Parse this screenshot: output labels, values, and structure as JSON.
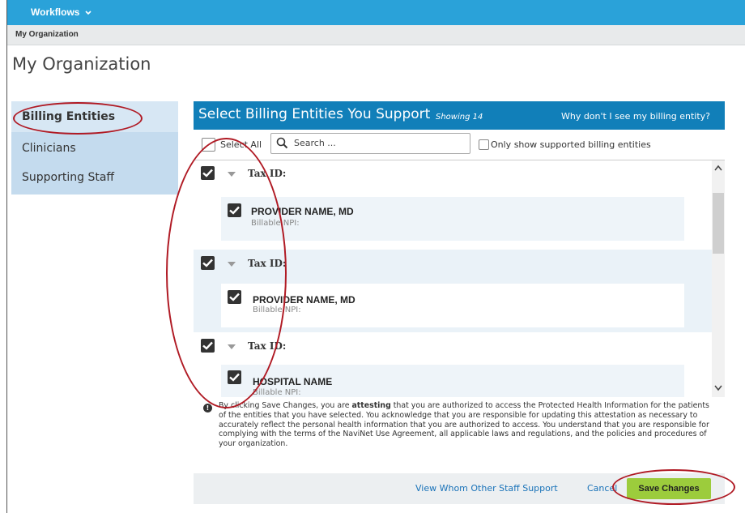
{
  "topbar": {
    "workflows_label": "Workflows",
    "chevron_icon": "chevron-down-icon",
    "color": "#2aa2d9"
  },
  "breadcrumb": {
    "label": "My Organization"
  },
  "page": {
    "title": "My Organization"
  },
  "sidebar": {
    "items": [
      {
        "label": "Billing Entities",
        "active": true
      },
      {
        "label": "Clinicians"
      },
      {
        "label": "Supporting Staff"
      }
    ]
  },
  "panel": {
    "title": "Select Billing Entities You Support",
    "showing": "Showing 14",
    "why_link": "Why don't I see my billing entity?",
    "header_color": "#117fb9"
  },
  "toolbar": {
    "select_all": "Select All",
    "search_placeholder": "Search ...",
    "only_supported": "Only show supported billing entities"
  },
  "entities": [
    {
      "tax_id_label": "Tax ID:",
      "provider": "PROVIDER NAME, MD",
      "npi_label": "Billable NPI:",
      "checked": true
    },
    {
      "tax_id_label": "Tax ID:",
      "provider": "PROVIDER NAME, MD",
      "npi_label": "Billable NPI:",
      "checked": true
    },
    {
      "tax_id_label": "Tax ID:",
      "provider": "HOSPITAL NAME",
      "npi_label": "Billable NPI:",
      "checked": true
    }
  ],
  "attestation": {
    "before": "By clicking Save Changes, you are ",
    "bold": "attesting",
    "after": " that you are authorized to access the Protected Health Information for the patients of the entities that you have selected. You acknowledge that you are responsible for updating this attestation as necessary to accurately reflect the personal health information that you are authorized to access. You understand that you are responsible for complying with the terms of the NaviNet Use Agreement, all applicable laws and regulations, and the policies and procedures of your organization."
  },
  "footer": {
    "view_link": "View Whom Other Staff Support",
    "cancel": "Cancel",
    "save": "Save Changes",
    "save_color": "#9ccc3c"
  }
}
